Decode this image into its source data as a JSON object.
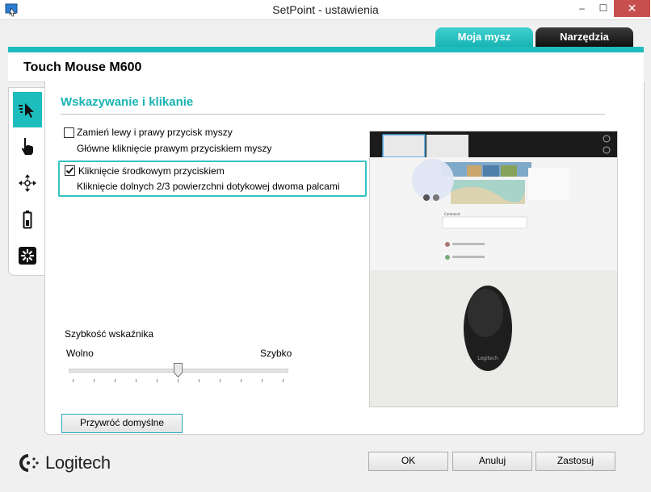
{
  "window": {
    "title": "SetPoint - ustawienia",
    "minimize": "–",
    "maximize": "☐",
    "close": "✕"
  },
  "tabs": [
    {
      "label": "Moja mysz",
      "active": true
    },
    {
      "label": "Narzędzia",
      "active": false
    }
  ],
  "device": {
    "name": "Touch Mouse M600"
  },
  "sidebar": {
    "items": [
      {
        "icon": "pointer-click-icon",
        "active": true
      },
      {
        "icon": "touch-gesture-icon",
        "active": false
      },
      {
        "icon": "move-arrows-icon",
        "active": false
      },
      {
        "icon": "battery-icon",
        "active": false
      },
      {
        "icon": "unifying-receiver-icon",
        "active": false
      }
    ]
  },
  "section": {
    "title": "Wskazywanie i klikanie",
    "options": [
      {
        "label": "Zamień lewy i prawy przycisk myszy",
        "description": "Główne kliknięcie prawym przyciskiem myszy",
        "checked": false
      },
      {
        "label": "Kliknięcie środkowym przyciskiem",
        "description": "Kliknięcie dolnych 2/3 powierzchni dotykowej dwoma palcami",
        "checked": true
      }
    ],
    "speed": {
      "label": "Szybkość wskaźnika",
      "min_label": "Wolno",
      "max_label": "Szybko",
      "value_fraction": 0.5,
      "tick_count": 11
    }
  },
  "preview_image": {
    "brand_text": "Logitech",
    "comment_title": "Comment"
  },
  "buttons": {
    "restore": "Przywróć domyślne",
    "ok": "OK",
    "cancel": "Anuluj",
    "apply": "Zastosuj"
  },
  "brand": {
    "logo_text": "Logitech"
  },
  "colors": {
    "accent": "#1ebdbd",
    "close": "#c7504f",
    "tab_dark": "#1a1a1a"
  }
}
